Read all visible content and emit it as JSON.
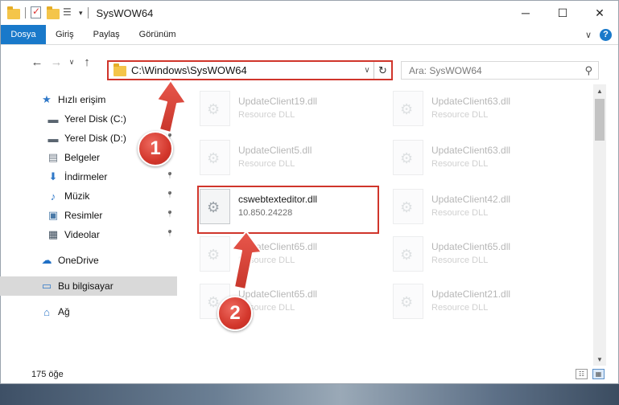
{
  "window": {
    "title": "SysWOW64",
    "controls": {
      "minimize": "─",
      "maximize": "☐",
      "close": "✕"
    }
  },
  "ribbon": {
    "file_tab": "Dosya",
    "tabs": [
      "Giriş",
      "Paylaş",
      "Görünüm"
    ],
    "expand": "∨",
    "help": "?"
  },
  "nav": {
    "back": "←",
    "forward": "→",
    "recent": "∨",
    "up": "↑",
    "address_path": "C:\\Windows\\SysWOW64",
    "address_dropdown": "∨",
    "refresh": "↻",
    "search_placeholder": "Ara: SysWOW64",
    "search_glyph": "⚲"
  },
  "sidebar": {
    "items": [
      {
        "label": "Hızlı erişim",
        "icon": "star-icon",
        "glyph": "★",
        "color": "#2f78c8",
        "pinned": false,
        "indent": 1
      },
      {
        "label": "Yerel Disk (C:)",
        "icon": "drive-icon",
        "glyph": "▬",
        "color": "#5a6570",
        "pinned": true,
        "indent": 2
      },
      {
        "label": "Yerel Disk (D:)",
        "icon": "drive-icon",
        "glyph": "▬",
        "color": "#5a6570",
        "pinned": true,
        "indent": 2
      },
      {
        "label": "Belgeler",
        "icon": "documents-icon",
        "glyph": "▤",
        "color": "#6e7a86",
        "pinned": true,
        "indent": 2
      },
      {
        "label": "İndirmeler",
        "icon": "downloads-icon",
        "glyph": "⬇",
        "color": "#2f78c8",
        "pinned": true,
        "indent": 2
      },
      {
        "label": "Müzik",
        "icon": "music-icon",
        "glyph": "♪",
        "color": "#2f78c8",
        "pinned": true,
        "indent": 2
      },
      {
        "label": "Resimler",
        "icon": "pictures-icon",
        "glyph": "▣",
        "color": "#4a7aa8",
        "pinned": true,
        "indent": 2
      },
      {
        "label": "Videolar",
        "icon": "videos-icon",
        "glyph": "▦",
        "color": "#3a4a5a",
        "pinned": true,
        "indent": 2
      },
      {
        "label": "OneDrive",
        "icon": "onedrive-icon",
        "glyph": "☁",
        "color": "#1f6fc5",
        "pinned": false,
        "indent": 1,
        "gap": true
      },
      {
        "label": "Bu bilgisayar",
        "icon": "computer-icon",
        "glyph": "▭",
        "color": "#2f78c8",
        "pinned": false,
        "indent": 1,
        "gap": true,
        "selected": true
      },
      {
        "label": "Ağ",
        "icon": "network-icon",
        "glyph": "⌂",
        "color": "#2f78c8",
        "pinned": false,
        "indent": 1,
        "gap": true
      }
    ],
    "pin_glyph": "📌"
  },
  "files": [
    {
      "name": "UpdateClient19.dll",
      "type": "Resource DLL",
      "faded": true
    },
    {
      "name": "UpdateClient63.dll",
      "type": "Resource DLL",
      "faded": true
    },
    {
      "name": "UpdateClient5.dll",
      "type": "Resource DLL",
      "faded": true
    },
    {
      "name": "UpdateClient63.dll",
      "type": "Resource DLL",
      "faded": true
    },
    {
      "name": "cswebtexteditor.dll",
      "type": "10.850.24228",
      "faded": false
    },
    {
      "name": "UpdateClient42.dll",
      "type": "Resource DLL",
      "faded": true
    },
    {
      "name": "UpdateClient65.dll",
      "type": "Resource DLL",
      "faded": true
    },
    {
      "name": "UpdateClient65.dll",
      "type": "Resource DLL",
      "faded": true
    },
    {
      "name": "UpdateClient65.dll",
      "type": "Resource DLL",
      "faded": true
    },
    {
      "name": "UpdateClient21.dll",
      "type": "Resource DLL",
      "faded": true
    }
  ],
  "status": {
    "count": "175 öğe"
  },
  "callouts": [
    {
      "number": "1"
    },
    {
      "number": "2"
    }
  ],
  "colors": {
    "accent": "#1979ca",
    "highlight": "#d0352b"
  }
}
